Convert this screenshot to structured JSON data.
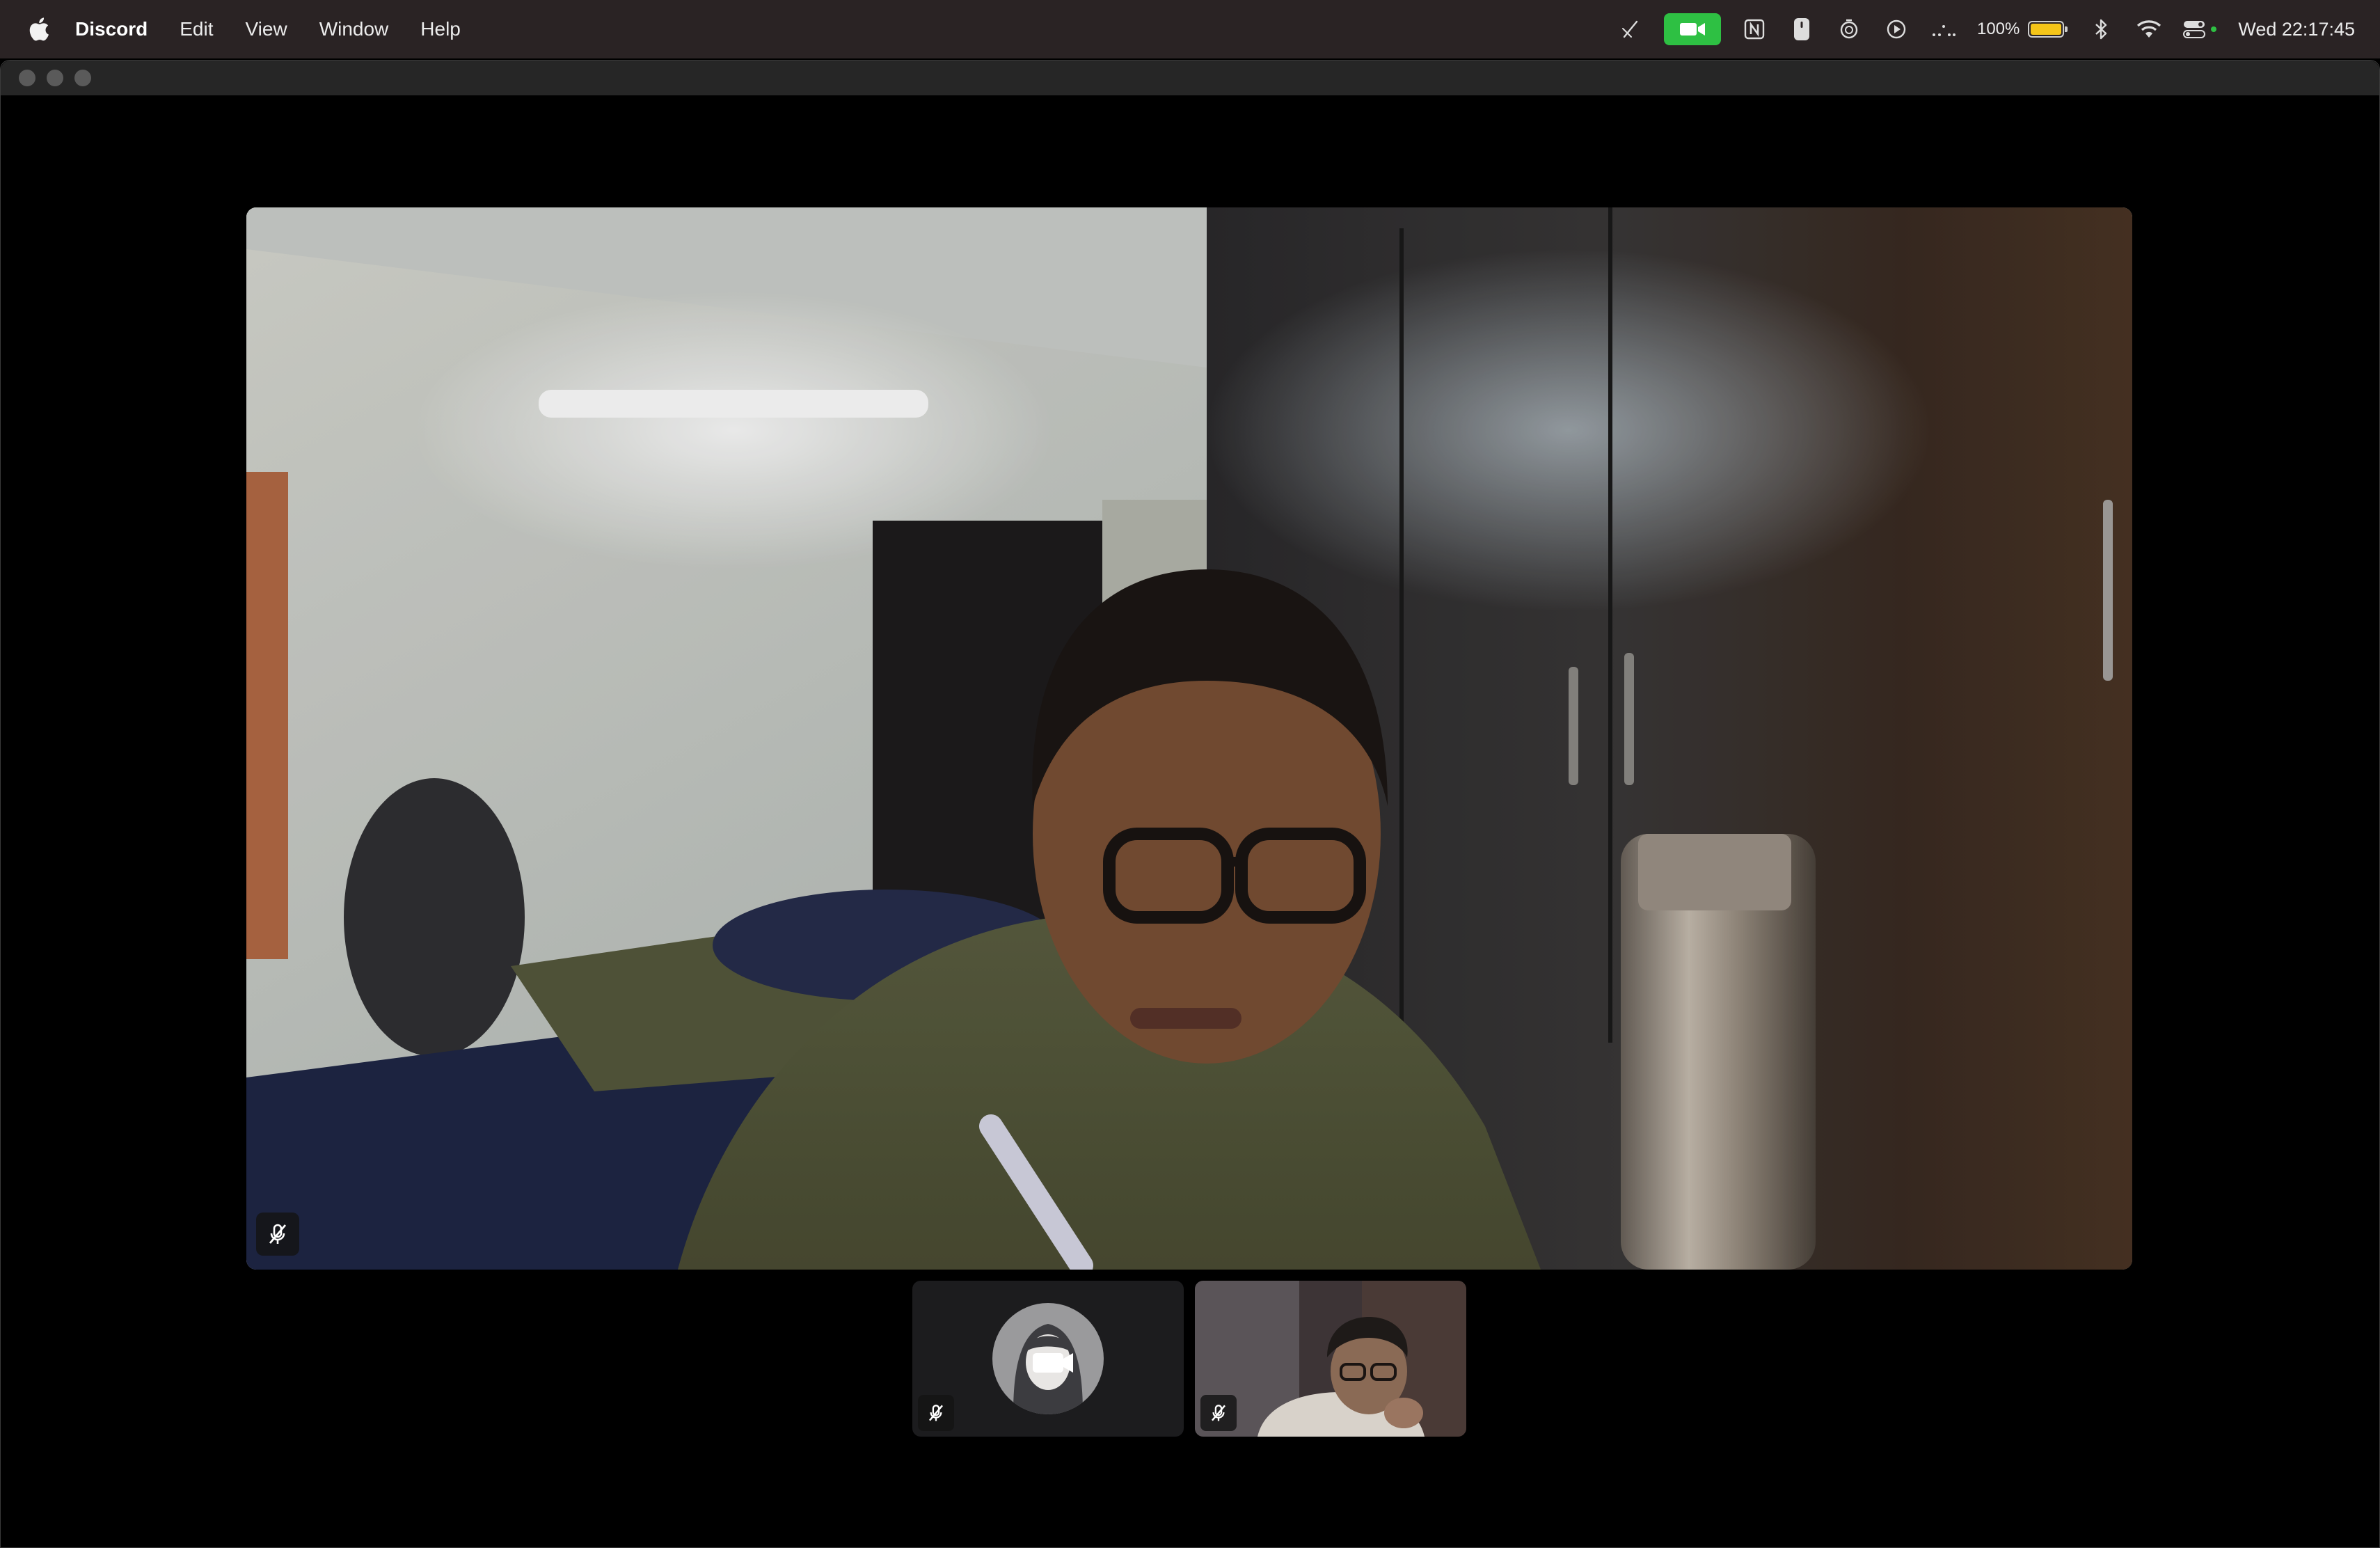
{
  "menubar": {
    "app_name": "Discord",
    "menus": [
      "Edit",
      "View",
      "Window",
      "Help"
    ],
    "status_icons": [
      "pen-slash-icon",
      "camera-in-use-icon",
      "notion-icon",
      "mouse-icon",
      "timer-icon",
      "play-icon",
      "dots-icon",
      "battery-icon",
      "bluetooth-icon",
      "wifi-icon",
      "control-center-icon"
    ],
    "battery_percent": "100%",
    "battery_fill": 1.0,
    "clock": "Wed 22:17:45",
    "camera_pill_color": "#2ec043"
  },
  "call": {
    "main_tile": {
      "video": "participant camera feed",
      "muted": true
    },
    "thumbnails": [
      {
        "kind": "avatar",
        "icon": "video-camera-icon",
        "muted": true
      },
      {
        "kind": "video",
        "muted": true
      }
    ]
  },
  "colors": {
    "menubar_bg": "#2a2324",
    "window_bg": "#000000",
    "titlebar_bg": "#262626"
  }
}
